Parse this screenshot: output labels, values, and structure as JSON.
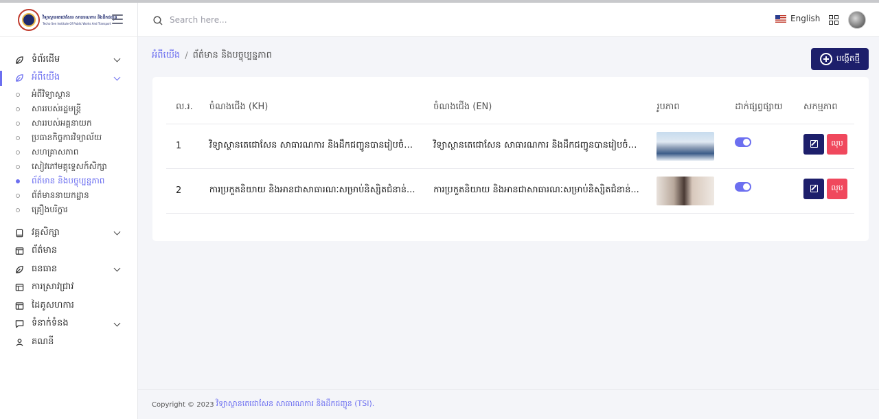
{
  "brand": {
    "name_kh": "វិទ្យាស្ថានតេជោសែន សាធារណការ និងដឹកជញ្ជូន",
    "name_en": "Techo Sen Institute Of Public Works And Transport",
    "logo_icon": "institute-seal-logo"
  },
  "header": {
    "search_placeholder": "Search here...",
    "language": "English",
    "language_flag": "us-flag-icon"
  },
  "sidebar": {
    "items": [
      {
        "label": "ទំព័រដើម",
        "icon": "leaf-icon",
        "has_chevron": true
      },
      {
        "label": "អំពីយើង",
        "icon": "leaf-icon",
        "has_chevron": true,
        "active": true,
        "children": [
          {
            "label": "អំពីវិទ្យាស្ថាន"
          },
          {
            "label": "សាររបស់រដ្ឋមន្ត្រី"
          },
          {
            "label": "សាររបស់អគ្គនាយក"
          },
          {
            "label": "ប្រធានកិច្ចការវិទ្យាល័យ"
          },
          {
            "label": "សហគ្រាសភាព"
          },
          {
            "label": "សៀវភៅមគ្គុទ្ទេសក៍សិក្សា"
          },
          {
            "label": "ព័ត៌មាន និងបច្ចុប្បន្នភាព",
            "active": true
          },
          {
            "label": "ព័ត៌មាននាយកដ្ឋាន"
          },
          {
            "label": "គ្រឿងបរិក្ខារ"
          }
        ]
      },
      {
        "label": "វគ្គសិក្សា",
        "icon": "book-icon",
        "has_chevron": true
      },
      {
        "label": "ព័ត៌មាន",
        "icon": "layout-icon",
        "has_chevron": false
      },
      {
        "label": "ធនធាន",
        "icon": "leaf-icon",
        "has_chevron": true
      },
      {
        "label": "ការស្រាវជ្រាវ",
        "icon": "layout-icon",
        "has_chevron": false
      },
      {
        "label": "ដៃគូសហការ",
        "icon": "layout-icon",
        "has_chevron": false
      },
      {
        "label": "ទំនាក់ទំនង",
        "icon": "chat-icon",
        "has_chevron": true
      },
      {
        "label": "គណនី",
        "icon": "user-icon",
        "has_chevron": false
      }
    ]
  },
  "breadcrumb": {
    "parent": "អំពីយើង",
    "current": "ព័ត៌មាន និងបច្ចុប្បន្នភាព"
  },
  "actions": {
    "create_label": "បង្កើតថ្មី"
  },
  "table": {
    "headers": {
      "no": "ល.រ.",
      "title_kh": "ចំណងជើង (KH)",
      "title_en": "ចំណងជើង (EN)",
      "image": "រូបភាព",
      "publish": "ដាក់ផ្សព្វផ្សាយ",
      "actions": "សកម្មភាព"
    },
    "rows": [
      {
        "no": "1",
        "title_kh": "វិទ្យាស្ថានតេជោសែន សាធារណការ និងដឹកជញ្ជូនបានរៀបចំក...",
        "title_en": "វិទ្យាស្ថានតេជោសែន សាធារណការ និងដឹកជញ្ជូនបានរៀបចំក...",
        "published": true,
        "delete_label": "លុប"
      },
      {
        "no": "2",
        "title_kh": "ការប្រកួតនិយាយ និងអានជាសាធារណៈសម្រាប់និស្សិតជំនាន់...",
        "title_en": "ការប្រកួតនិយាយ និងអានជាសាធារណៈសម្រាប់និស្សិតជំនាន់...",
        "published": true,
        "delete_label": "លុប"
      }
    ]
  },
  "footer": {
    "copyright": "Copyright © 2023",
    "org": "វិទ្យាស្ថានតេជោសែន សាធារណការ និងដឹកជញ្ជូន (TSI)."
  },
  "colors": {
    "accent": "#6c6ff0",
    "primary_button": "#1d1f6b",
    "danger_button": "#f0485d"
  }
}
